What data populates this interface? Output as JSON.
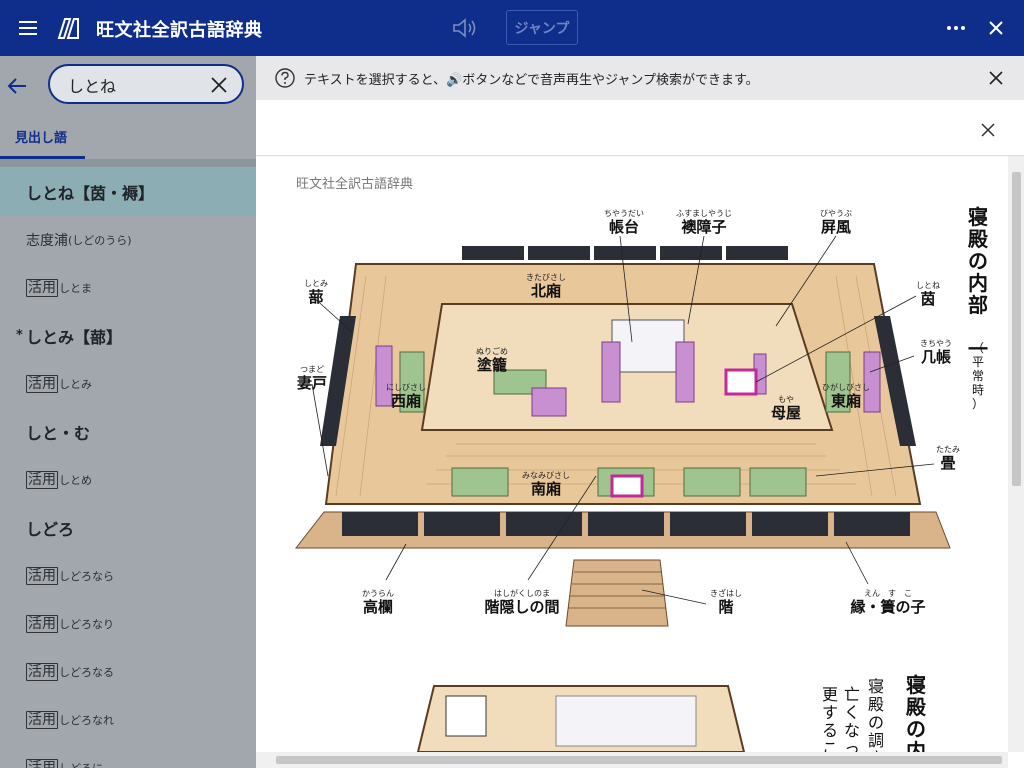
{
  "titlebar": {
    "title": "旺文社全訳古語辞典",
    "jump_label": "ジャンプ",
    "icons": [
      "hamburger-menu-icon",
      "dictionary-logo-icon",
      "speaker-icon",
      "more-icon",
      "close-icon"
    ]
  },
  "search": {
    "query": "しとね"
  },
  "tabs": [
    {
      "label": "見出し語"
    }
  ],
  "entries": [
    {
      "text": "しとね【茵・褥】",
      "style": "bold",
      "selected": true
    },
    {
      "text": "志度浦",
      "small": "(しどのうら)",
      "style": "normal"
    },
    {
      "badge": "活用",
      "small": "しとま",
      "style": "normal"
    },
    {
      "mark": "*",
      "text": "しとみ【蔀】",
      "style": "bold"
    },
    {
      "badge": "活用",
      "small": "しとみ",
      "style": "normal"
    },
    {
      "text": "しと・む",
      "style": "bold"
    },
    {
      "badge": "活用",
      "small": "しとめ",
      "style": "normal"
    },
    {
      "text": "しどろ",
      "style": "bold"
    },
    {
      "badge": "活用",
      "small": "しどろなら",
      "style": "normal"
    },
    {
      "badge": "活用",
      "small": "しどろなり",
      "style": "normal"
    },
    {
      "badge": "活用",
      "small": "しどろなる",
      "style": "normal"
    },
    {
      "badge": "活用",
      "small": "しどろなれ",
      "style": "normal"
    },
    {
      "badge": "活用",
      "small": "しどろに",
      "style": "normal"
    }
  ],
  "notice": {
    "text": "テキストを選択すると、🔊ボタンなどで音声再生やジャンプ検索ができます。"
  },
  "viewer": {
    "source": "旺文社全訳古語辞典",
    "figure_title": "寝殿の内部 一",
    "figure_subtitle": "（平常時）",
    "figure_title_2": "寝殿の内",
    "vertical_text": [
      "寝殿の調度",
      "亡くなった",
      "更すること"
    ],
    "labels": [
      {
        "text": "帳台",
        "ruby": "ちやうだい"
      },
      {
        "text": "襖障子",
        "ruby": "ふすましやうじ"
      },
      {
        "text": "屏風",
        "ruby": "びやうぶ"
      },
      {
        "text": "北廂",
        "ruby": "きたびさし"
      },
      {
        "text": "蔀",
        "ruby": "しとみ"
      },
      {
        "text": "茵",
        "ruby": "しとね"
      },
      {
        "text": "塗籠",
        "ruby": "ぬりごめ"
      },
      {
        "text": "几帳",
        "ruby": "きちやう"
      },
      {
        "text": "妻戸",
        "ruby": "つまど"
      },
      {
        "text": "西廂",
        "ruby": "にしびさし"
      },
      {
        "text": "東廂",
        "ruby": "ひがしびさし"
      },
      {
        "text": "母屋",
        "ruby": "もや"
      },
      {
        "text": "畳",
        "ruby": "たたみ"
      },
      {
        "text": "南廂",
        "ruby": "みなみびさし"
      },
      {
        "text": "高欄",
        "ruby": "かうらん"
      },
      {
        "text": "階隠しの間",
        "ruby": "はしがくしのま"
      },
      {
        "text": "階",
        "ruby": "きざはし"
      },
      {
        "text": "縁・簀の子",
        "ruby": "えん　す　こ"
      }
    ]
  }
}
